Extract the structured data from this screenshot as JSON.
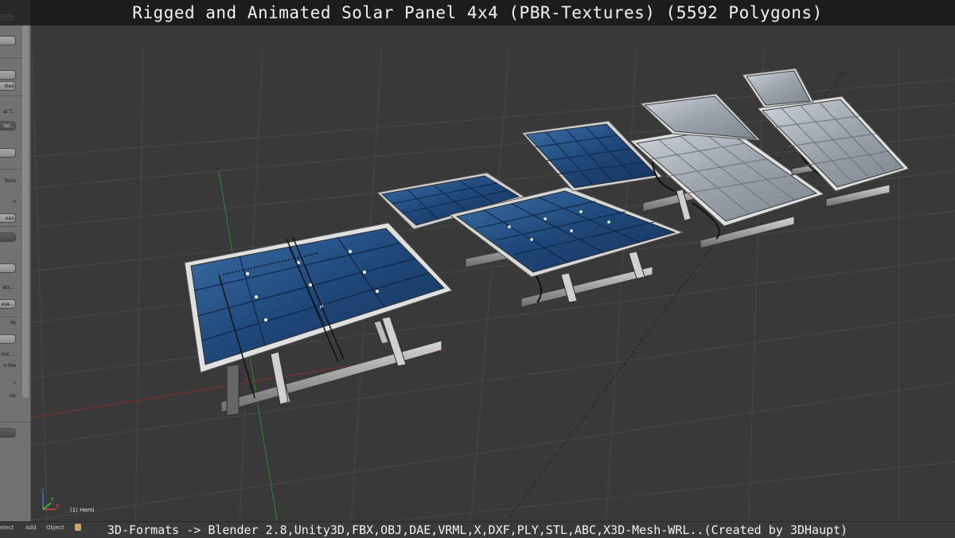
{
  "title": "Rigged and Animated Solar Panel 4x4 (PBR-Textures) (5592 Polygons)",
  "footer": "3D-Formats -> Blender 2.8,Unity3D,FBX,OBJ,DAE,VRML,X,DXF,PLY,STL,ABC,X3D-Mesh-WRL..(Created by 3DHaupt)",
  "viewport": {
    "object_label": "(1) Hemi",
    "axes": {
      "x": "X",
      "y": "Y",
      "z": "Z"
    }
  },
  "header_menu": {
    "items": [
      "elect",
      "Add",
      "Object"
    ]
  },
  "tool_shelf": {
    "items": [
      {
        "text": "",
        "kind": "button"
      },
      {
        "text": "",
        "kind": "button"
      },
      {
        "text": "",
        "kind": "button"
      },
      {
        "text": "iked",
        "kind": "button"
      },
      {
        "text": "al T...",
        "kind": "label"
      },
      {
        "text": "lor...",
        "kind": "dark"
      },
      {
        "text": "",
        "kind": "button"
      },
      {
        "text": "Tools",
        "kind": "label"
      },
      {
        "text": "n",
        "kind": "label"
      },
      {
        "text": "ean",
        "kind": "button"
      },
      {
        "text": "",
        "kind": "dark"
      },
      {
        "text": "",
        "kind": "button"
      },
      {
        "text": "ets ...",
        "kind": "label"
      },
      {
        "text": "ese...",
        "kind": "button"
      },
      {
        "text": "ky",
        "kind": "label"
      },
      {
        "text": "",
        "kind": "button"
      },
      {
        "text": "mic ...",
        "kind": "label"
      },
      {
        "text": "n the",
        "kind": "label"
      },
      {
        "text": "r",
        "kind": "label"
      },
      {
        "text": "ols",
        "kind": "label"
      },
      {
        "text": "",
        "kind": "dark"
      }
    ]
  },
  "colors": {
    "viewport_bg": "#393939",
    "grid_line": "#4a4a4a",
    "x_axis": "#8a2f2f",
    "y_axis": "#3c8a3c",
    "panel_blue": "#1e3e6a",
    "panel_silver": "#9ea5ae",
    "frame": "#d4d4d4"
  }
}
